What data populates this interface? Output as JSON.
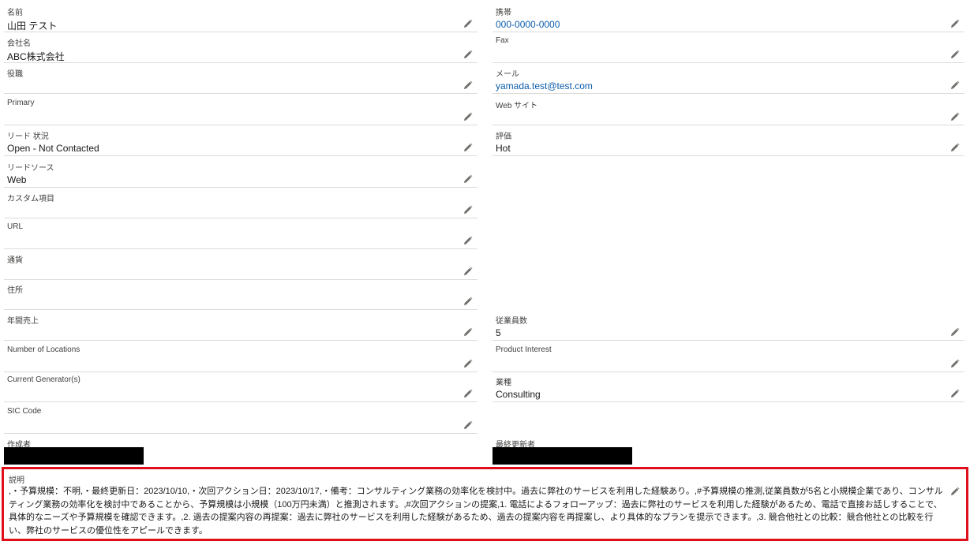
{
  "fields": {
    "name": {
      "label": "名前",
      "value": "山田 テスト"
    },
    "mobile": {
      "label": "携帯",
      "value": "000-0000-0000"
    },
    "company": {
      "label": "会社名",
      "value": "ABC株式会社"
    },
    "fax": {
      "label": "Fax",
      "value": ""
    },
    "title": {
      "label": "役職",
      "value": ""
    },
    "email": {
      "label": "メール",
      "value": "yamada.test@test.com"
    },
    "primary": {
      "label": "Primary",
      "value": ""
    },
    "website": {
      "label": "Web サイト",
      "value": ""
    },
    "lead_status": {
      "label": "リード 状況",
      "value": "Open - Not Contacted"
    },
    "rating": {
      "label": "評価",
      "value": "Hot"
    },
    "lead_source": {
      "label": "リードソース",
      "value": "Web"
    },
    "custom_field": {
      "label": "カスタム項目",
      "value": ""
    },
    "url": {
      "label": "URL",
      "value": ""
    },
    "currency": {
      "label": "通貨",
      "value": ""
    },
    "address": {
      "label": "住所",
      "value": ""
    },
    "annual_revenue": {
      "label": "年間売上",
      "value": ""
    },
    "employees": {
      "label": "従業員数",
      "value": "5"
    },
    "num_locations": {
      "label": "Number of Locations",
      "value": ""
    },
    "product_interest": {
      "label": "Product Interest",
      "value": ""
    },
    "current_generators": {
      "label": "Current Generator(s)",
      "value": ""
    },
    "industry": {
      "label": "業種",
      "value": "Consulting"
    },
    "sic_code": {
      "label": "SIC Code",
      "value": ""
    },
    "created_by": {
      "label": "作成者"
    },
    "last_modified_by": {
      "label": "最終更新者"
    }
  },
  "description": {
    "label": "説明",
    "value": ",・予算規模：不明,・最終更新日：2023/10/10,・次回アクション日：2023/10/17,・備考：コンサルティング業務の効率化を検討中。過去に弊社のサービスを利用した経験あり。,#予算規模の推測,従業員数が5名と小規模企業であり、コンサルティング業務の効率化を検討中であることから、予算規模は小規模（100万円未満）と推測されます。,#次回アクションの提案,1. 電話によるフォローアップ：過去に弊社のサービスを利用した経験があるため、電話で直接お話しすることで、具体的なニーズや予算規模を確認できます。,2. 過去の提案内容の再提案：過去に弊社のサービスを利用した経験があるため、過去の提案内容を再提案し、より具体的なプランを提示できます。,3. 競合他社との比較：競合他社との比較を行い、弊社のサービスの優位性をアピールできます。"
  },
  "colors": {
    "link": "#0b5cab",
    "highlight_border": "#e0101b",
    "divider": "#dddbda"
  },
  "icons": {
    "edit": "pencil-icon"
  }
}
